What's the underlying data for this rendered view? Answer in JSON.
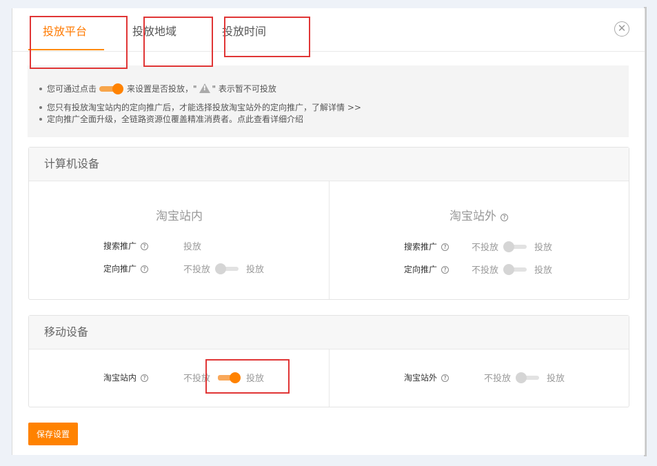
{
  "tabs": [
    {
      "label": "投放平台",
      "active": true
    },
    {
      "label": "投放地域",
      "active": false
    },
    {
      "label": "投放时间",
      "active": false
    }
  ],
  "close_icon": "close-icon",
  "notice": {
    "line1_pre": "您可通过点击",
    "line1_mid": "来设置是否投放，\"",
    "line1_post": "\" 表示暂不可投放",
    "line2_pre": "您只有投放淘宝站内的定向推广后，才能选择投放淘宝站外的定向推广，",
    "line2_link": "了解详情 >>",
    "line3": "定向推广全面升级，全链路资源位覆盖精准消费者。点此查看详细介绍"
  },
  "computer": {
    "title": "计算机设备",
    "inside": {
      "title": "淘宝站内",
      "search_label": "搜索推广",
      "search_status": "投放",
      "target_label": "定向推广",
      "target_off": "不投放",
      "target_on": "投放"
    },
    "outside": {
      "title": "淘宝站外",
      "search_label": "搜索推广",
      "search_off": "不投放",
      "search_on": "投放",
      "target_label": "定向推广",
      "target_off": "不投放",
      "target_on": "投放"
    }
  },
  "mobile": {
    "title": "移动设备",
    "inside_label": "淘宝站内",
    "inside_off": "不投放",
    "inside_on": "投放",
    "outside_label": "淘宝站外",
    "outside_off": "不投放",
    "outside_on": "投放"
  },
  "save_label": "保存设置",
  "colors": {
    "accent": "#ff8200",
    "annotation": "#e03535"
  }
}
